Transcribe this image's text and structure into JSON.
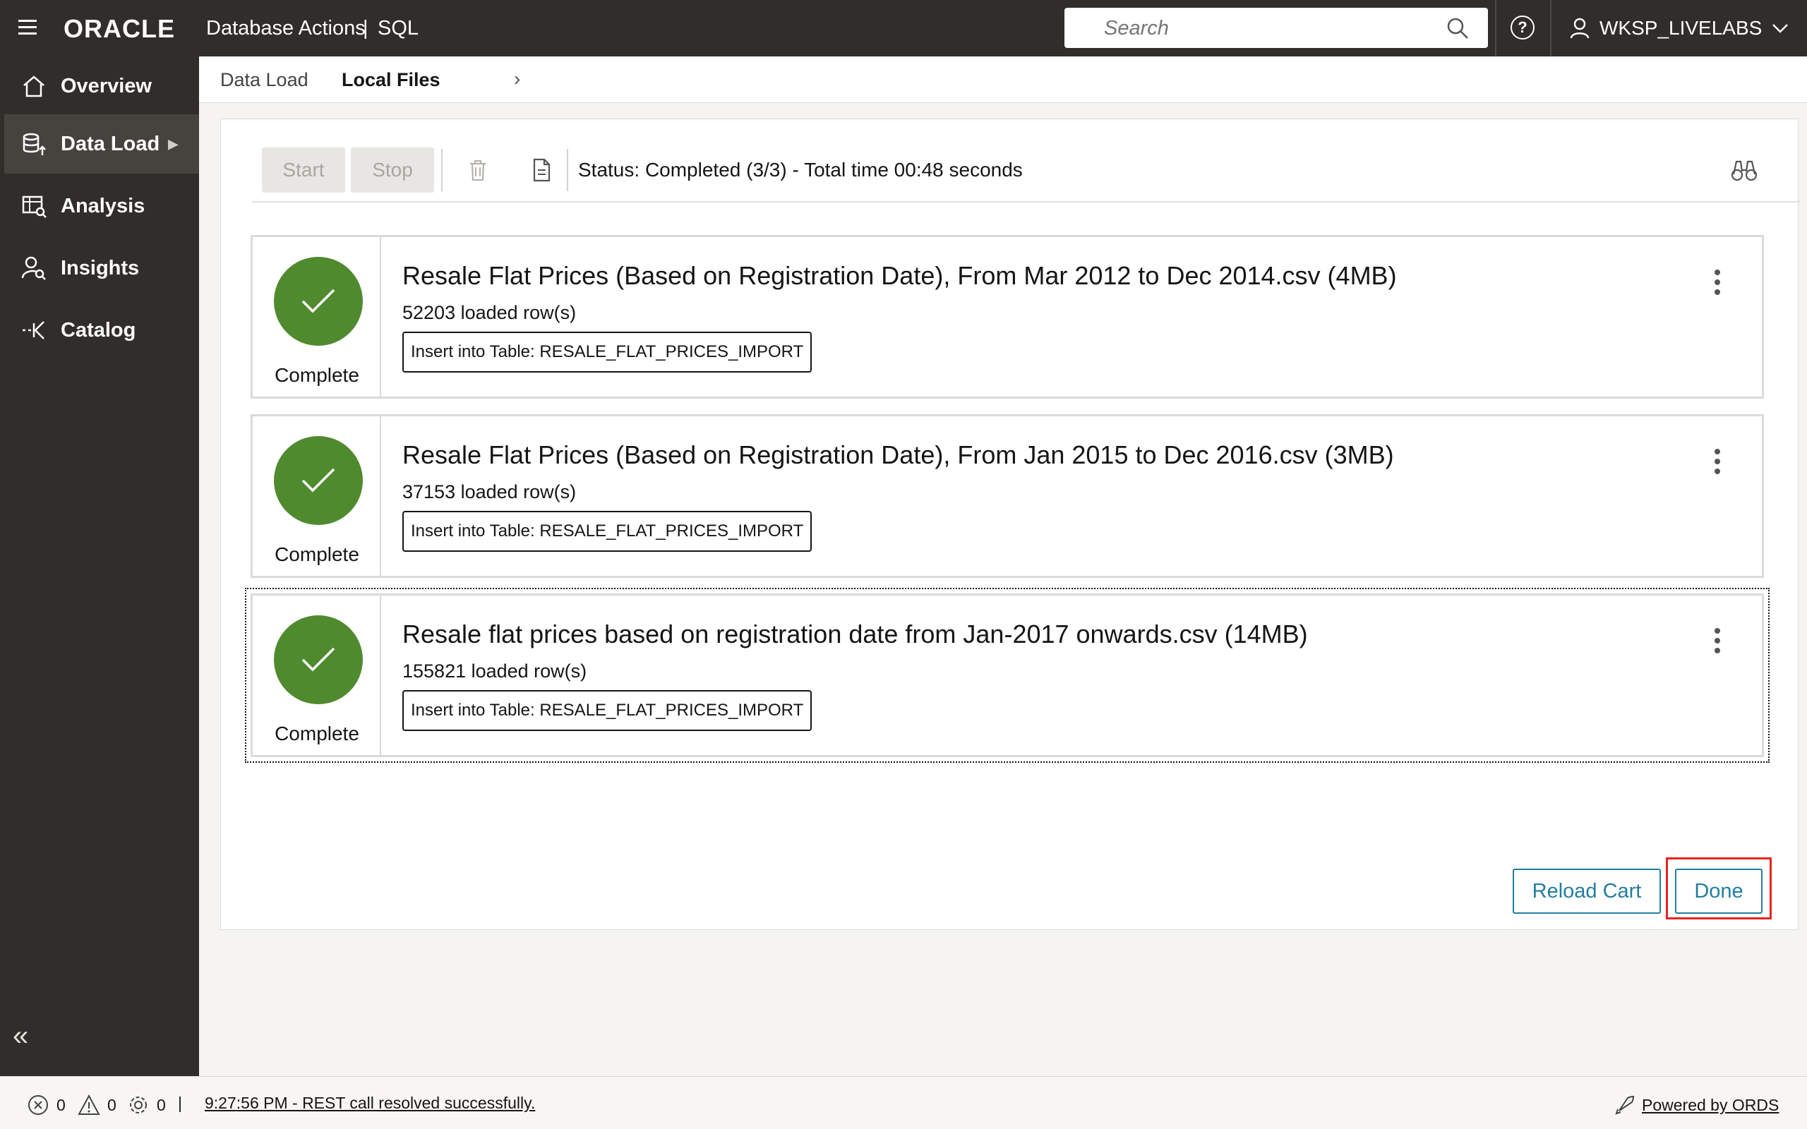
{
  "header": {
    "logo": "ORACLE",
    "app_title": "Database Actions",
    "separator": "|",
    "app_section": "SQL",
    "search_placeholder": "Search",
    "user": "WKSP_LIVELABS"
  },
  "sidebar": {
    "items": [
      {
        "label": "Overview",
        "icon": "home-icon"
      },
      {
        "label": "Data Load",
        "icon": "database-upload-icon",
        "active": true
      },
      {
        "label": "Analysis",
        "icon": "table-analysis-icon"
      },
      {
        "label": "Insights",
        "icon": "person-search-icon"
      },
      {
        "label": "Catalog",
        "icon": "catalog-icon"
      }
    ]
  },
  "breadcrumb": {
    "parent": "Data Load",
    "current": "Local Files"
  },
  "toolbar": {
    "start_label": "Start",
    "stop_label": "Stop",
    "status": "Status: Completed (3/3) - Total time 00:48 seconds"
  },
  "jobs": [
    {
      "status": "Complete",
      "file": "Resale Flat Prices (Based on Registration Date), From Mar 2012 to Dec 2014.csv (4MB)",
      "rows": "52203 loaded row(s)",
      "target": "Insert into Table: RESALE_FLAT_PRICES_IMPORT"
    },
    {
      "status": "Complete",
      "file": "Resale Flat Prices (Based on Registration Date), From Jan 2015 to Dec 2016.csv (3MB)",
      "rows": "37153 loaded row(s)",
      "target": "Insert into Table: RESALE_FLAT_PRICES_IMPORT"
    },
    {
      "status": "Complete",
      "file": "Resale flat prices based on registration date from Jan-2017 onwards.csv (14MB)",
      "rows": "155821 loaded row(s)",
      "target": "Insert into Table: RESALE_FLAT_PRICES_IMPORT"
    }
  ],
  "actions": {
    "reload_label": "Reload Cart",
    "done_label": "Done"
  },
  "statusbar": {
    "errors": "0",
    "warnings": "0",
    "tasks": "0",
    "divider": "|",
    "message": "9:27:56 PM - REST call resolved successfully.",
    "powered": "Powered by ORDS"
  },
  "colors": {
    "topbar": "#312d2a",
    "success": "#508a2f",
    "accent": "#227e9e",
    "highlight": "#e8231f"
  }
}
